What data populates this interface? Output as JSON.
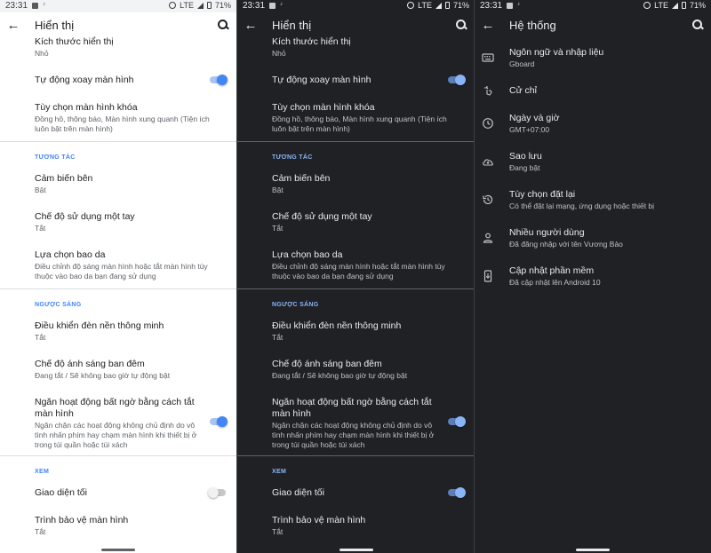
{
  "status": {
    "time": "23:31",
    "network": "LTE",
    "battery": "71%"
  },
  "display": {
    "title": "Hiển thị",
    "rows": {
      "display_size": {
        "title": "Kích thước hiển thị",
        "summary": "Nhỏ"
      },
      "auto_rotate": {
        "title": "Tự động xoay màn hình"
      },
      "lock_screen": {
        "title": "Tùy chọn màn hình khóa",
        "summary": "Đồng hồ, thông báo, Màn hình xung quanh (Tiện ích luôn bật trên màn hình)"
      },
      "edge_sensor": {
        "title": "Cảm biến bên",
        "summary": "Bật"
      },
      "one_hand": {
        "title": "Chế độ sử dụng một tay",
        "summary": "Tắt"
      },
      "cover": {
        "title": "Lựa chọn bao da",
        "summary": "Điều chỉnh độ sáng màn hình hoặc tắt màn hình tùy thuộc vào bao da bạn đang sử dụng"
      },
      "smart_backlight": {
        "title": "Điều khiển đèn nền thông minh",
        "summary": "Tắt"
      },
      "night_light": {
        "title": "Chế độ ánh sáng ban đêm",
        "summary": "Đang tắt / Sẽ không bao giờ tự động bật"
      },
      "prevent_touch": {
        "title": "Ngăn hoạt động bất ngờ bằng cách tắt màn hình",
        "summary": "Ngăn chặn các hoạt động không chủ định do vô tình nhấn phím hay chạm màn hình khi thiết bị ở trong túi quần hoặc túi xách"
      },
      "dark_theme": {
        "title": "Giao diện tối"
      },
      "screensaver": {
        "title": "Trình bảo vệ màn hình",
        "summary": "Tắt"
      }
    },
    "sections": {
      "interaction": "TƯƠNG TÁC",
      "backlight": "NGƯỢC SÁNG",
      "view": "XEM"
    },
    "toggles_light": {
      "auto_rotate": true,
      "prevent_touch": true,
      "dark_theme": false
    },
    "toggles_dark": {
      "auto_rotate": true,
      "prevent_touch": true,
      "dark_theme": true
    }
  },
  "system": {
    "title": "Hệ thống",
    "items": [
      {
        "icon": "keyboard-icon",
        "title": "Ngôn ngữ và nhập liệu",
        "summary": "Gboard"
      },
      {
        "icon": "gesture-icon",
        "title": "Cử chỉ",
        "summary": ""
      },
      {
        "icon": "clock-icon",
        "title": "Ngày và giờ",
        "summary": "GMT+07:00"
      },
      {
        "icon": "cloud-backup-icon",
        "title": "Sao lưu",
        "summary": "Đang bật"
      },
      {
        "icon": "history-reset-icon",
        "title": "Tùy chọn đặt lại",
        "summary": "Có thể đặt lại mạng, ứng dụng hoặc thiết bị"
      },
      {
        "icon": "person-icon",
        "title": "Nhiều người dùng",
        "summary": "Đã đăng nhập với tên Vương Bảo"
      },
      {
        "icon": "system-update-icon",
        "title": "Cập nhật phần mềm",
        "summary": "Đã cập nhật lên Android 10"
      }
    ]
  },
  "colors": {
    "accent_light": "#4285f4",
    "accent_dark": "#8ab4f8",
    "dark_bg": "#202124",
    "light_bg": "#ffffff"
  }
}
